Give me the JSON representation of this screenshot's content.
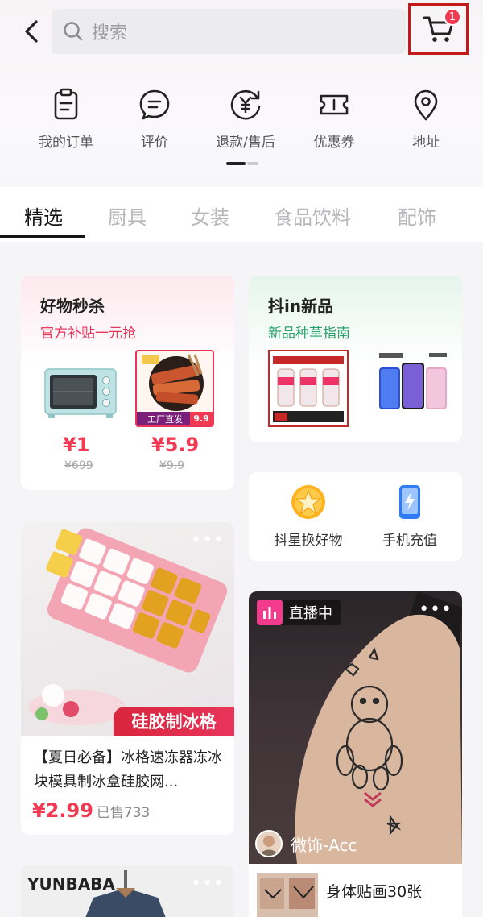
{
  "header": {
    "back_icon": "chevron-left-icon",
    "search_placeholder": "搜索",
    "cart_badge": "1"
  },
  "quick_links": [
    {
      "label": "我的订单",
      "icon": "order-icon"
    },
    {
      "label": "评价",
      "icon": "comment-icon"
    },
    {
      "label": "退款/售后",
      "icon": "refund-icon"
    },
    {
      "label": "优惠券",
      "icon": "coupon-icon"
    },
    {
      "label": "地址",
      "icon": "location-icon"
    }
  ],
  "tabs": [
    "精选",
    "厨具",
    "女装",
    "食品饮料",
    "配饰"
  ],
  "flash_sale": {
    "title": "好物秒杀",
    "subtitle": "官方补贴一元抢",
    "items": [
      {
        "price": "¥1",
        "original": "¥699"
      },
      {
        "price": "¥5.9",
        "original": "¥9.9",
        "badge_left": "工厂直发",
        "badge_right": "9.9"
      }
    ]
  },
  "new_arrivals": {
    "title": "抖in新品",
    "subtitle": "新品种草指南"
  },
  "shortcuts": [
    {
      "label": "抖星换好物",
      "icon": "star-badge-icon"
    },
    {
      "label": "手机充值",
      "icon": "phone-charge-icon"
    }
  ],
  "product_card": {
    "image_tag": "硅胶制冰格",
    "title": "【夏日必备】冰格速冻器冻冰块模具制冰盒硅胶网...",
    "price": "¥2.99",
    "sold": "已售733"
  },
  "live_card": {
    "badge": "直播中",
    "streamer": "微饰-Acc",
    "product_title": "身体贴画30张"
  },
  "colors": {
    "accent_red": "#f23b52",
    "cart_highlight": "#c41a1a",
    "subtitle_pink": "#e8355a",
    "subtitle_green": "#2aa06a"
  }
}
